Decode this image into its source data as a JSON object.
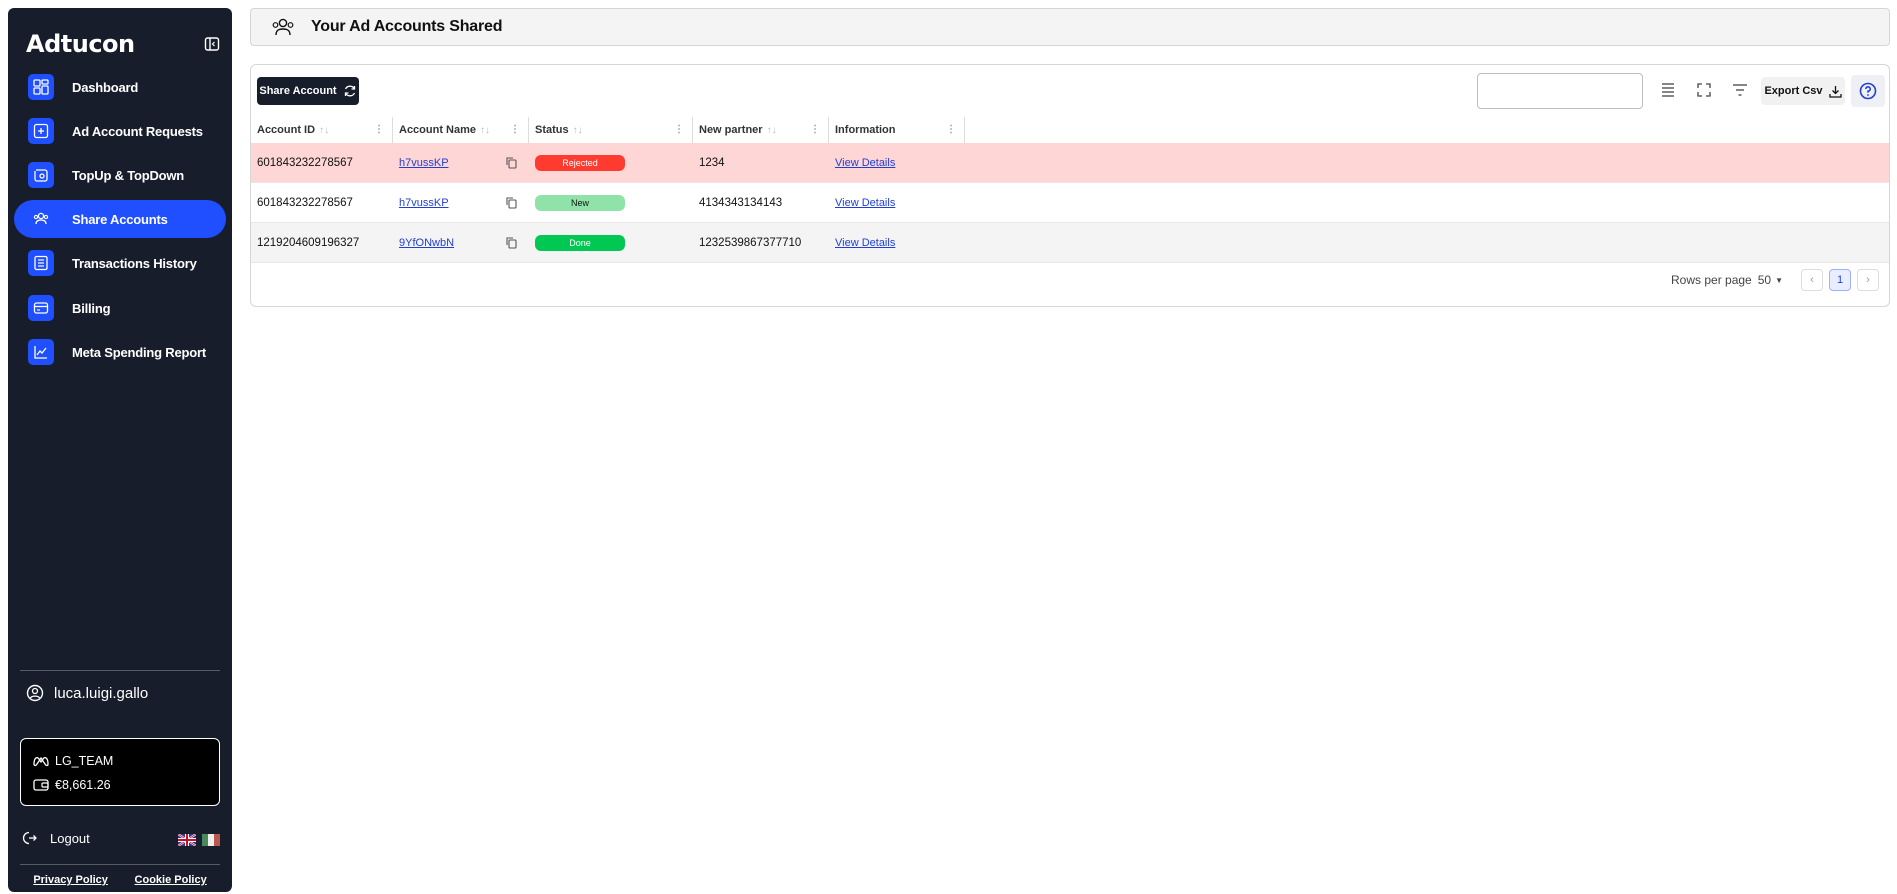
{
  "brand": {
    "name": "Adtucon",
    "accent": "#1f4fff",
    "sidebar_bg": "#171d2b"
  },
  "sidebar": {
    "items": [
      {
        "label": "Dashboard",
        "icon": "dashboard-icon"
      },
      {
        "label": "Ad Account Requests",
        "icon": "plus-square-icon"
      },
      {
        "label": "TopUp & TopDown",
        "icon": "wallet-icon"
      },
      {
        "label": "Share Accounts",
        "icon": "users-icon",
        "active": true
      },
      {
        "label": "Transactions History",
        "icon": "list-icon"
      },
      {
        "label": "Billing",
        "icon": "card-icon"
      },
      {
        "label": "Meta Spending Report",
        "icon": "chart-line-icon"
      }
    ],
    "user": "luca.luigi.gallo",
    "wallet": {
      "team": "LG_TEAM",
      "balance": "€8,661.26"
    },
    "logout": "Logout",
    "footer": {
      "privacy": "Privacy Policy",
      "cookie": "Cookie Policy"
    }
  },
  "header": {
    "title": "Your Ad Accounts Shared"
  },
  "toolbar": {
    "share_label": "Share Account",
    "search_placeholder": "",
    "export_label": "Export Csv"
  },
  "table": {
    "columns": [
      "Account ID",
      "Account Name",
      "Status",
      "New partner",
      "Information"
    ],
    "rows": [
      {
        "account_id": "601843232278567",
        "account_name": "h7vussKP",
        "status": "Rejected",
        "status_color": "#ff3b30",
        "partner": "1234",
        "info": "View Details"
      },
      {
        "account_id": "601843232278567",
        "account_name": "h7vussKP",
        "status": "New",
        "status_color": "#8fe3a8",
        "partner": "4134343134143",
        "info": "View Details"
      },
      {
        "account_id": "1219204609196327",
        "account_name": "9YfONwbN",
        "status": "Done",
        "status_color": "#00c853",
        "partner": "1232539867377710",
        "info": "View Details"
      }
    ]
  },
  "pagination": {
    "rows_label": "Rows per page",
    "rows_value": "50",
    "current_page": "1"
  }
}
